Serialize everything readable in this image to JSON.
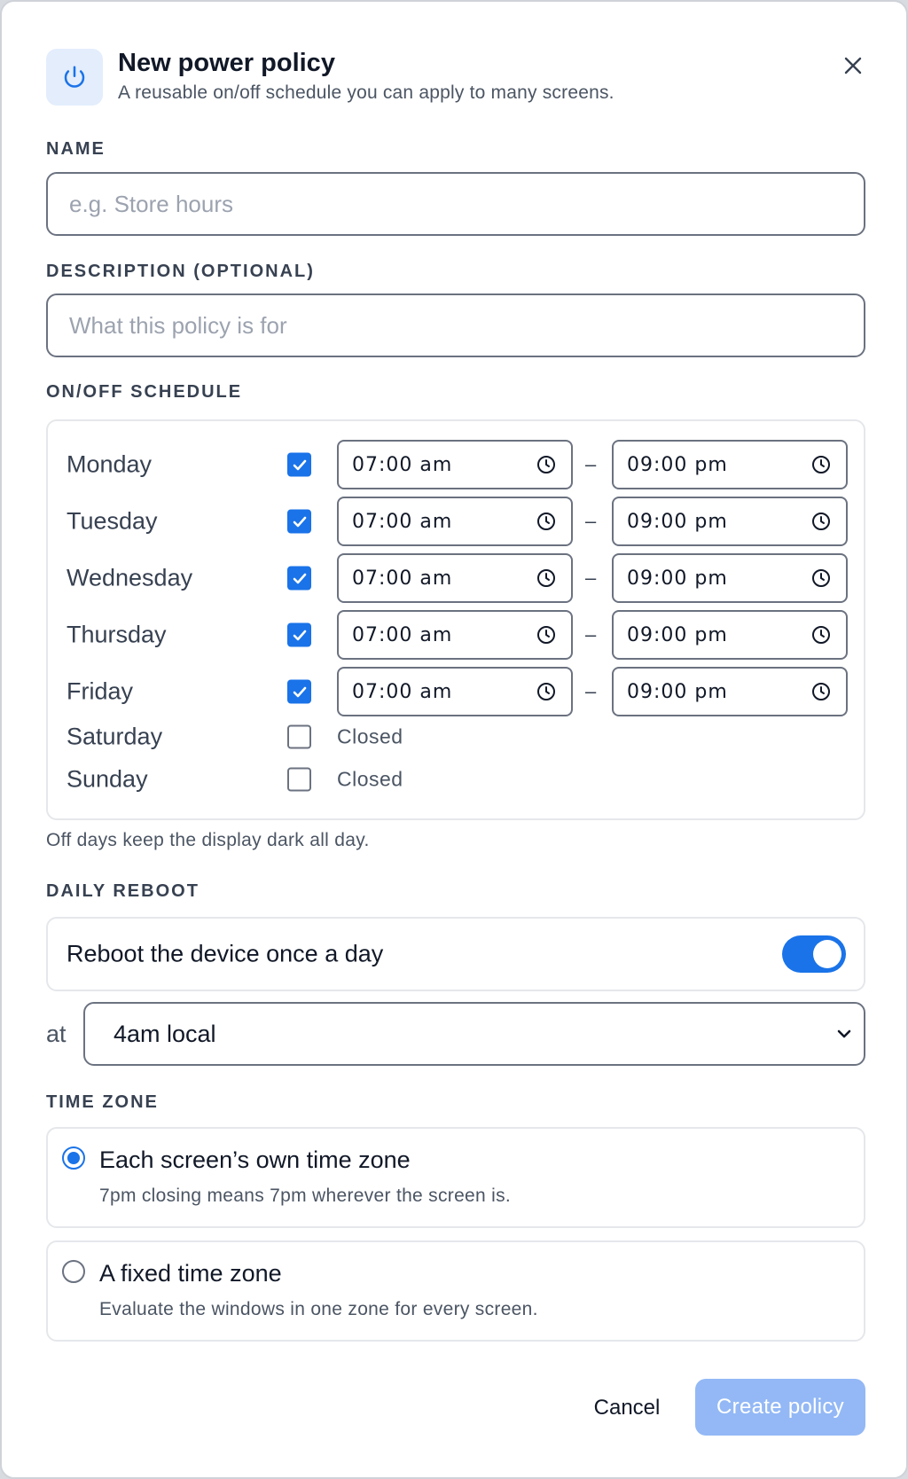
{
  "header": {
    "title": "New power policy",
    "subtitle": "A reusable on/off schedule you can apply to many screens.",
    "icon": "power-icon",
    "close_icon": "close-icon"
  },
  "name": {
    "label": "NAME",
    "placeholder": "e.g. Store hours",
    "value": ""
  },
  "description": {
    "label": "DESCRIPTION (OPTIONAL)",
    "placeholder": "What this policy is for",
    "value": ""
  },
  "schedule": {
    "label": "ON/OFF SCHEDULE",
    "separator": "–",
    "days": [
      {
        "name": "Monday",
        "enabled": true,
        "start": "07:00 am",
        "end": "09:00 pm"
      },
      {
        "name": "Tuesday",
        "enabled": true,
        "start": "07:00 am",
        "end": "09:00 pm"
      },
      {
        "name": "Wednesday",
        "enabled": true,
        "start": "07:00 am",
        "end": "09:00 pm"
      },
      {
        "name": "Thursday",
        "enabled": true,
        "start": "07:00 am",
        "end": "09:00 pm"
      },
      {
        "name": "Friday",
        "enabled": true,
        "start": "07:00 am",
        "end": "09:00 pm"
      },
      {
        "name": "Saturday",
        "enabled": false,
        "status": "Closed"
      },
      {
        "name": "Sunday",
        "enabled": false,
        "status": "Closed"
      }
    ],
    "hint": "Off days keep the display dark all day."
  },
  "reboot": {
    "label": "DAILY REBOOT",
    "text": "Reboot the device once a day",
    "enabled": true,
    "at_label": "at",
    "selected": "4am local"
  },
  "timezone": {
    "label": "TIME ZONE",
    "options": [
      {
        "title": "Each screen’s own time zone",
        "description": "7pm closing means 7pm wherever the screen is.",
        "selected": true
      },
      {
        "title": "A fixed time zone",
        "description": "Evaluate the windows in one zone for every screen.",
        "selected": false
      }
    ]
  },
  "footer": {
    "cancel": "Cancel",
    "create": "Create policy"
  },
  "colors": {
    "accent": "#1a73e8",
    "accent_disabled": "#93b8f5",
    "icon_bg": "#e3edfc"
  }
}
